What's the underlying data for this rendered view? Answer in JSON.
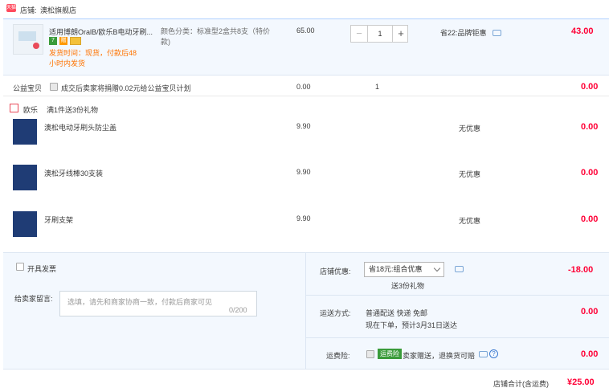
{
  "shop": {
    "badge": "天猫",
    "label": "店铺:",
    "name": "澳松旗舰店"
  },
  "main_item": {
    "title": "适用博朗OralB/欧乐B电动牙刷...",
    "tags": [
      "7",
      "赠"
    ],
    "shipping": "发货时间：现货，付款后48小时内发货",
    "spec": "颜色分类：标准型2盒共8支（特价款)",
    "price": "65.00",
    "quantity": "1",
    "minus": "−",
    "plus": "+",
    "promo": "省22:品牌钜惠",
    "total": "43.00"
  },
  "charity": {
    "label": "公益宝贝",
    "text": "成交后卖家将捐赠0.02元给公益宝贝计划",
    "price": "0.00",
    "quantity": "1",
    "total": "0.00"
  },
  "gift_header": {
    "brand": "欧乐",
    "text": "满1件送3份礼物"
  },
  "gifts": [
    {
      "name": "澳松电动牙刷头防尘盖",
      "price": "9.90",
      "promo": "无优惠",
      "total": "0.00"
    },
    {
      "name": "澳松牙线棒30支装",
      "price": "9.90",
      "promo": "无优惠",
      "total": "0.00"
    },
    {
      "name": "牙刷支架",
      "price": "9.90",
      "promo": "无优惠",
      "total": "0.00"
    }
  ],
  "invoice": {
    "label": "开具发票"
  },
  "message": {
    "label": "给卖家留言:",
    "placeholder": "选填，请先和商家协商一致，付款后商家可见",
    "counter": "0/200"
  },
  "shop_promo": {
    "label": "店铺优惠:",
    "selected": "省18元:组合优惠",
    "sub": "送3份礼物",
    "amount": "-18.00"
  },
  "delivery": {
    "label": "运送方式:",
    "method": "普通配送 快递 免邮",
    "eta": "现在下单，预计3月31日送达",
    "amount": "0.00"
  },
  "insurance": {
    "label": "运费险:",
    "badge": "运费险",
    "text": "卖家赠送，退换货可赔",
    "amount": "0.00"
  },
  "footer": {
    "label": "店铺合计(含运费)",
    "total": "¥25.00"
  },
  "colors": {
    "accent_red": "#ff0036",
    "row_bg": "#f3f8fe",
    "orange": "#ff7300",
    "green": "#3a9b3a"
  }
}
